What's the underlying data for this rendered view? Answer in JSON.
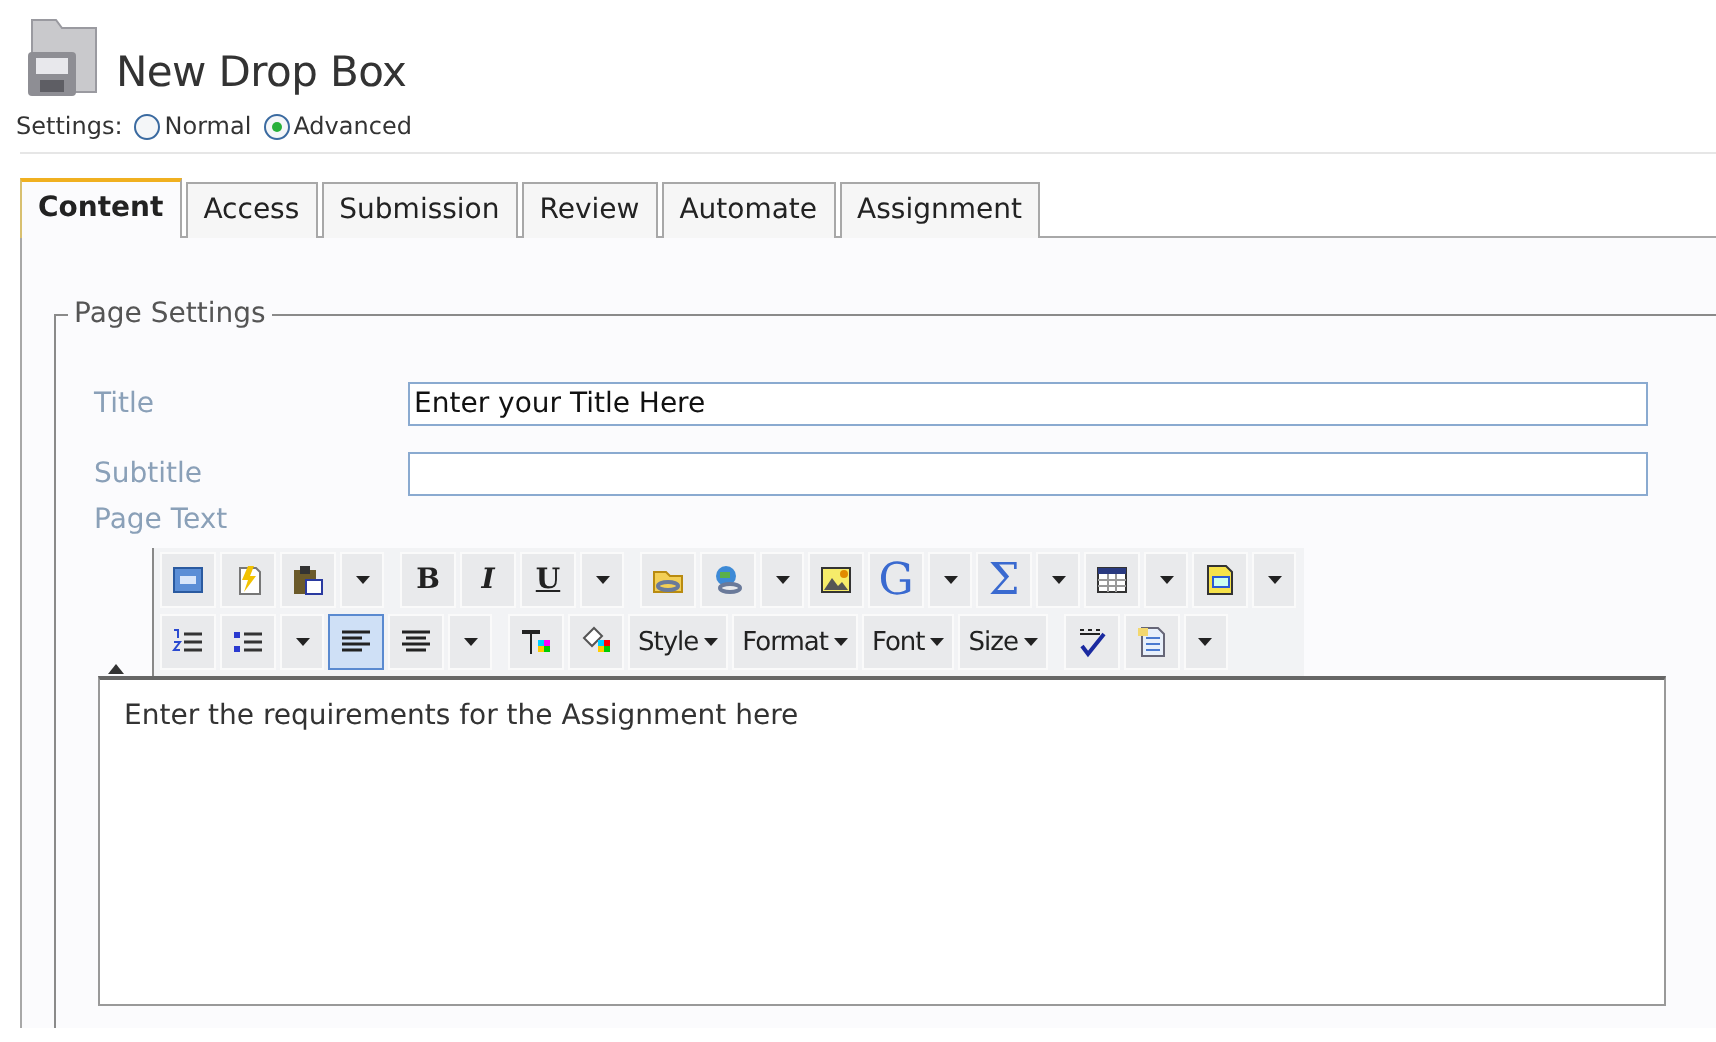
{
  "page": {
    "title": "New Drop Box"
  },
  "settings": {
    "label": "Settings:",
    "options": [
      {
        "label": "Normal",
        "selected": false
      },
      {
        "label": "Advanced",
        "selected": true
      }
    ]
  },
  "tabs": [
    {
      "label": "Content",
      "selected": true
    },
    {
      "label": "Access",
      "selected": false
    },
    {
      "label": "Submission",
      "selected": false
    },
    {
      "label": "Review",
      "selected": false
    },
    {
      "label": "Automate",
      "selected": false
    },
    {
      "label": "Assignment",
      "selected": false
    }
  ],
  "fieldset": {
    "legend": "Page Settings",
    "fields": [
      {
        "label": "Title",
        "value": "Enter your Title Here"
      },
      {
        "label": "Subtitle"
      }
    ],
    "page_text_label": "Page Text"
  },
  "editor": {
    "toolbar_rows": [
      [
        {
          "kind": "icon"
        },
        {
          "kind": "icon"
        },
        {
          "kind": "icon"
        },
        {
          "kind": "arrow"
        },
        {
          "kind": "sep"
        },
        {
          "kind": "glyph",
          "label": "B"
        },
        {
          "kind": "glyph",
          "label": "I"
        },
        {
          "kind": "glyph",
          "label": "U"
        },
        {
          "kind": "arrow"
        },
        {
          "kind": "sep"
        },
        {
          "kind": "icon"
        },
        {
          "kind": "icon"
        },
        {
          "kind": "arrow"
        },
        {
          "kind": "icon"
        },
        {
          "kind": "glyph",
          "label": "G"
        },
        {
          "kind": "arrow"
        },
        {
          "kind": "glyph",
          "label": "Σ"
        },
        {
          "kind": "arrow"
        },
        {
          "kind": "icon"
        },
        {
          "kind": "arrow"
        },
        {
          "kind": "icon"
        },
        {
          "kind": "arrow"
        }
      ],
      [
        {
          "kind": "icon"
        },
        {
          "kind": "icon"
        },
        {
          "kind": "arrow"
        },
        {
          "kind": "icon",
          "selected": true
        },
        {
          "kind": "icon",
          "selected": false
        },
        {
          "kind": "arrow"
        },
        {
          "kind": "sep"
        },
        {
          "kind": "icon"
        },
        {
          "kind": "icon"
        },
        {
          "kind": "menu",
          "label": "Style"
        },
        {
          "kind": "menu",
          "label": "Format"
        },
        {
          "kind": "menu",
          "label": "Font"
        },
        {
          "kind": "menu",
          "label": "Size"
        },
        {
          "kind": "sep"
        },
        {
          "kind": "icon"
        },
        {
          "kind": "icon"
        },
        {
          "kind": "arrow"
        }
      ]
    ],
    "body_text": "Enter the requirements for the Assignment here"
  }
}
